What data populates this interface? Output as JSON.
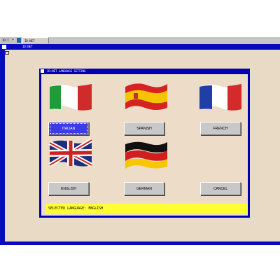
{
  "taskbar": {
    "combo_value": "ID:T",
    "task_label": "ID:NET"
  },
  "app": {
    "title": "ID:NET"
  },
  "dialog": {
    "title": "ID:NET LANGUAGE SETTING",
    "buttons": {
      "italian": "ITALIAN",
      "spanish": "SPANISH",
      "french": "FRENCH",
      "english": "ENGLISH",
      "german": "GERMAN",
      "cancel": "CANCEL"
    },
    "selected_button": "italian",
    "status": "SELECTED LANGUAGE: ENGLISH"
  },
  "colors": {
    "window_blue": "#0a0abd",
    "dialog_blue": "#0000b0",
    "client_beige": "#e9dac6",
    "status_yellow": "#ffff33",
    "selected_button": "#3c3ce6"
  }
}
